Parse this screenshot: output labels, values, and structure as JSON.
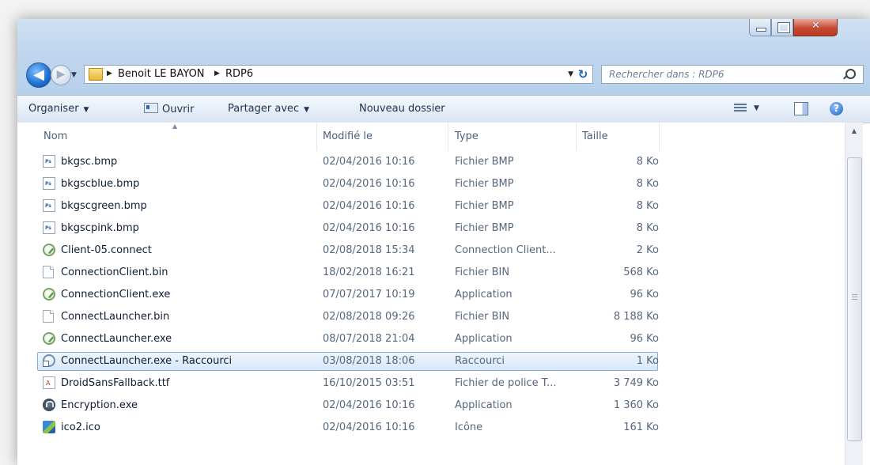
{
  "nav": {
    "back_label": "◀",
    "forward_label": "▶",
    "breadcrumb": [
      "Benoit LE BAYON",
      "RDP6"
    ]
  },
  "search": {
    "placeholder": "Rechercher dans : RDP6"
  },
  "toolbar": {
    "organize_label": "Organiser",
    "open_label": "Ouvrir",
    "share_label": "Partager avec",
    "new_folder_label": "Nouveau dossier"
  },
  "columns": {
    "name": "Nom",
    "modified": "Modifié le",
    "type": "Type",
    "size": "Taille"
  },
  "files": [
    {
      "name": "bkgsc.bmp",
      "modified": "02/04/2016 10:16",
      "type": "Fichier BMP",
      "size": "8 Ko",
      "icon": "bmp-icon"
    },
    {
      "name": "bkgscblue.bmp",
      "modified": "02/04/2016 10:16",
      "type": "Fichier BMP",
      "size": "8 Ko",
      "icon": "bmp-icon"
    },
    {
      "name": "bkgscgreen.bmp",
      "modified": "02/04/2016 10:16",
      "type": "Fichier BMP",
      "size": "8 Ko",
      "icon": "bmp-icon"
    },
    {
      "name": "bkgscpink.bmp",
      "modified": "02/04/2016 10:16",
      "type": "Fichier BMP",
      "size": "8 Ko",
      "icon": "bmp-icon"
    },
    {
      "name": "Client-05.connect",
      "modified": "02/08/2018 15:34",
      "type": "Connection Client...",
      "size": "2 Ko",
      "icon": "app-icon"
    },
    {
      "name": "ConnectionClient.bin",
      "modified": "18/02/2018 16:21",
      "type": "Fichier BIN",
      "size": "568 Ko",
      "icon": "file-icon"
    },
    {
      "name": "ConnectionClient.exe",
      "modified": "07/07/2017 10:19",
      "type": "Application",
      "size": "96 Ko",
      "icon": "app-icon"
    },
    {
      "name": "ConnectLauncher.bin",
      "modified": "02/08/2018 09:26",
      "type": "Fichier BIN",
      "size": "8 188 Ko",
      "icon": "file-icon"
    },
    {
      "name": "ConnectLauncher.exe",
      "modified": "08/07/2018 21:04",
      "type": "Application",
      "size": "96 Ko",
      "icon": "app-icon"
    },
    {
      "name": "ConnectLauncher.exe - Raccourci",
      "modified": "03/08/2018 18:06",
      "type": "Raccourci",
      "size": "1 Ko",
      "icon": "shortcut-icon",
      "selected": true
    },
    {
      "name": "DroidSansFallback.ttf",
      "modified": "16/10/2015 03:51",
      "type": "Fichier de police T...",
      "size": "3 749 Ko",
      "icon": "font-icon"
    },
    {
      "name": "Encryption.exe",
      "modified": "02/04/2016 10:16",
      "type": "Application",
      "size": "1 360 Ko",
      "icon": "encryption-icon"
    },
    {
      "name": "ico2.ico",
      "modified": "02/04/2016 10:16",
      "type": "Icône",
      "size": "161 Ko",
      "icon": "ico-icon"
    }
  ]
}
